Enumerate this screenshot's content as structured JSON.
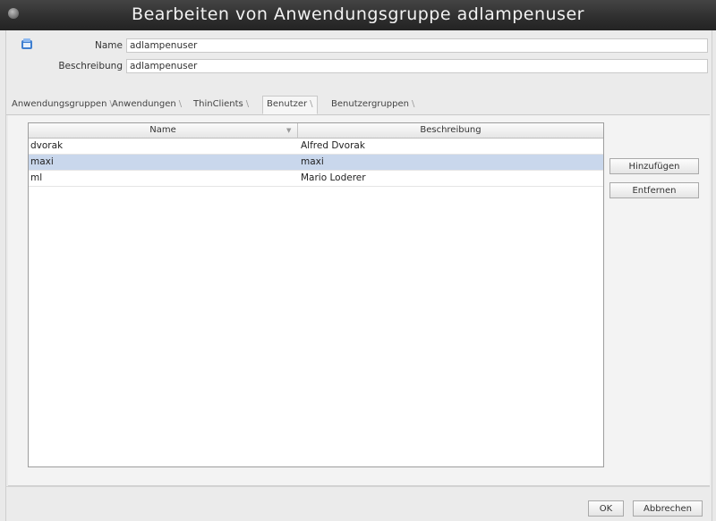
{
  "window": {
    "title": "Bearbeiten von Anwendungsgruppe adlampenuser"
  },
  "form": {
    "name_label": "Name",
    "name_value": "adlampenuser",
    "description_label": "Beschreibung",
    "description_value": "adlampenuser"
  },
  "tabs": [
    {
      "label": "Anwendungsgruppen",
      "active": false
    },
    {
      "label": "Anwendungen",
      "active": false
    },
    {
      "label": "ThinClients",
      "active": false
    },
    {
      "label": "Benutzer",
      "active": true
    },
    {
      "label": "Benutzergruppen",
      "active": false
    }
  ],
  "table": {
    "columns": [
      "Name",
      "Beschreibung"
    ],
    "rows": [
      {
        "name": "dvorak",
        "description": "Alfred Dvorak",
        "selected": false
      },
      {
        "name": "maxi",
        "description": "maxi",
        "selected": true
      },
      {
        "name": "ml",
        "description": "Mario Loderer",
        "selected": false
      }
    ]
  },
  "side_buttons": {
    "add": "Hinzufügen",
    "remove": "Entfernen"
  },
  "footer_buttons": {
    "ok": "OK",
    "cancel": "Abbrechen"
  },
  "colors": {
    "selection": "#c9d7ec",
    "titlebar": "#2f2f2f",
    "background": "#ebebeb"
  }
}
